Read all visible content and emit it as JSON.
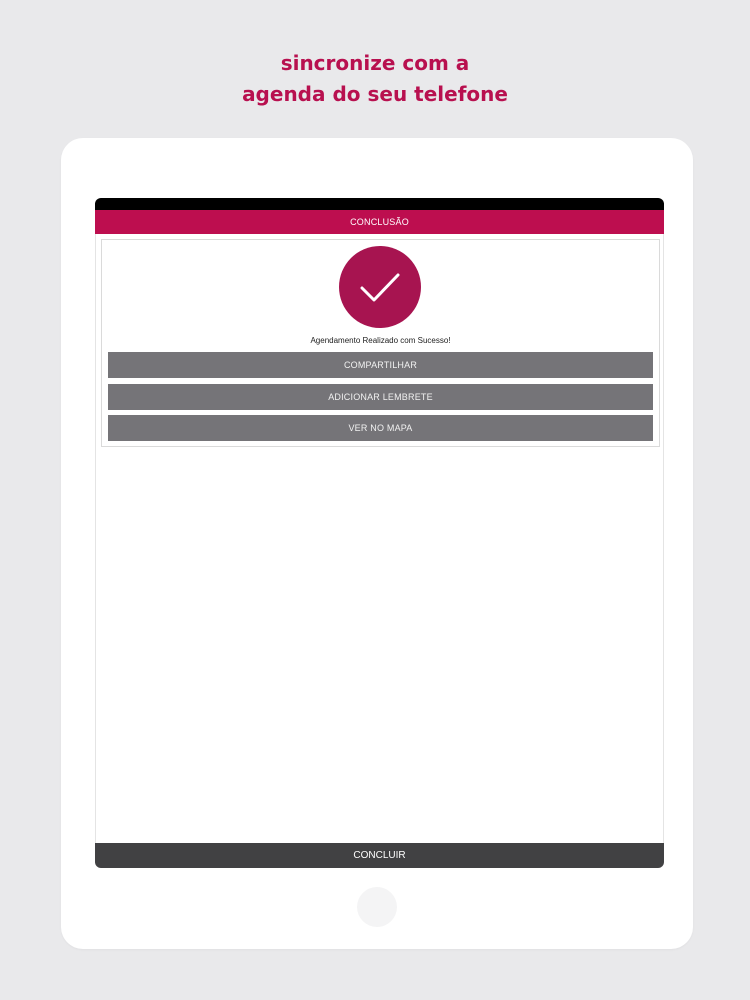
{
  "headline": {
    "line1": "sincronize com a",
    "line2": "agenda do seu telefone"
  },
  "app": {
    "header_title": "CONCLUSÃO",
    "success_message": "Agendamento Realizado com Sucesso!",
    "actions": [
      {
        "label": "COMPARTILHAR"
      },
      {
        "label": "ADICIONAR LEMBRETE"
      },
      {
        "label": "VER NO MAPA"
      }
    ],
    "footer_button": "CONCLUIR"
  },
  "icons": {
    "success": "check-icon"
  },
  "colors": {
    "accent": "#bd0e4f",
    "check_circle": "#a71450",
    "action_button": "#757478",
    "footer": "#414143",
    "headline": "#b8104f"
  }
}
